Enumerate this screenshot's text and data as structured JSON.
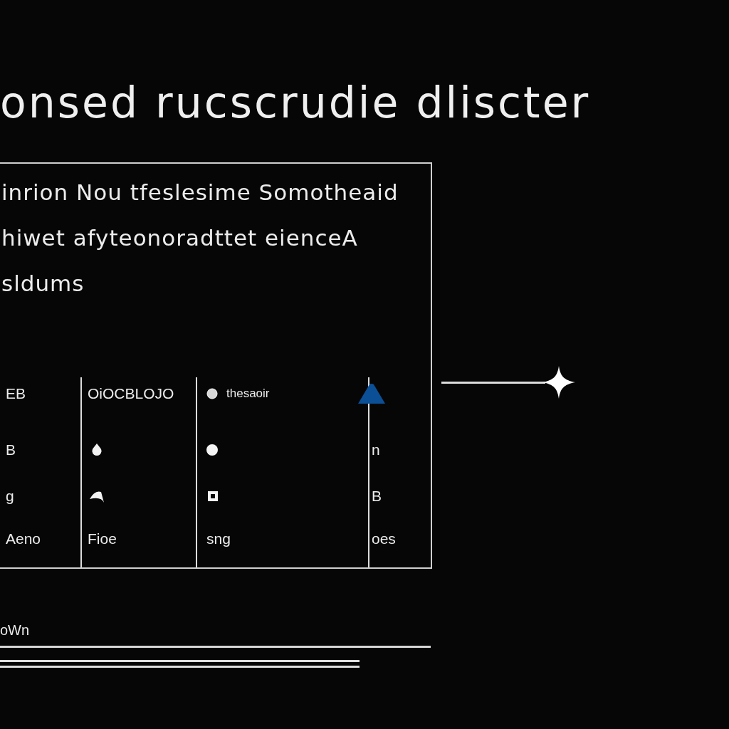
{
  "title": "onsed rucscrudie dliscter",
  "panel": {
    "lines": [
      "inrion Nou tfeslesime Somotheaid",
      "hiwet afyteonoradttet eienceA",
      "sldums"
    ],
    "table": {
      "rows": [
        {
          "cells": [
            {
              "kind": "text",
              "text": "EB"
            },
            {
              "kind": "text",
              "text": "OiOCBLOJO"
            },
            {
              "kind": "bullet_text",
              "text": "thesaoir"
            },
            {
              "kind": "triangle"
            }
          ]
        },
        {
          "cells": [
            {
              "kind": "text",
              "text": "B"
            },
            {
              "kind": "drop"
            },
            {
              "kind": "dot"
            },
            {
              "kind": "text",
              "text": "n"
            }
          ]
        },
        {
          "cells": [
            {
              "kind": "text",
              "text": "g"
            },
            {
              "kind": "arc"
            },
            {
              "kind": "square"
            },
            {
              "kind": "text",
              "text": "B"
            }
          ]
        },
        {
          "cells": [
            {
              "kind": "text",
              "text": "Aeno"
            },
            {
              "kind": "text",
              "text": "Fioe"
            },
            {
              "kind": "text",
              "text": "sng"
            },
            {
              "kind": "text",
              "text": "oes"
            }
          ]
        }
      ]
    }
  },
  "footer": {
    "label": "oWn"
  }
}
